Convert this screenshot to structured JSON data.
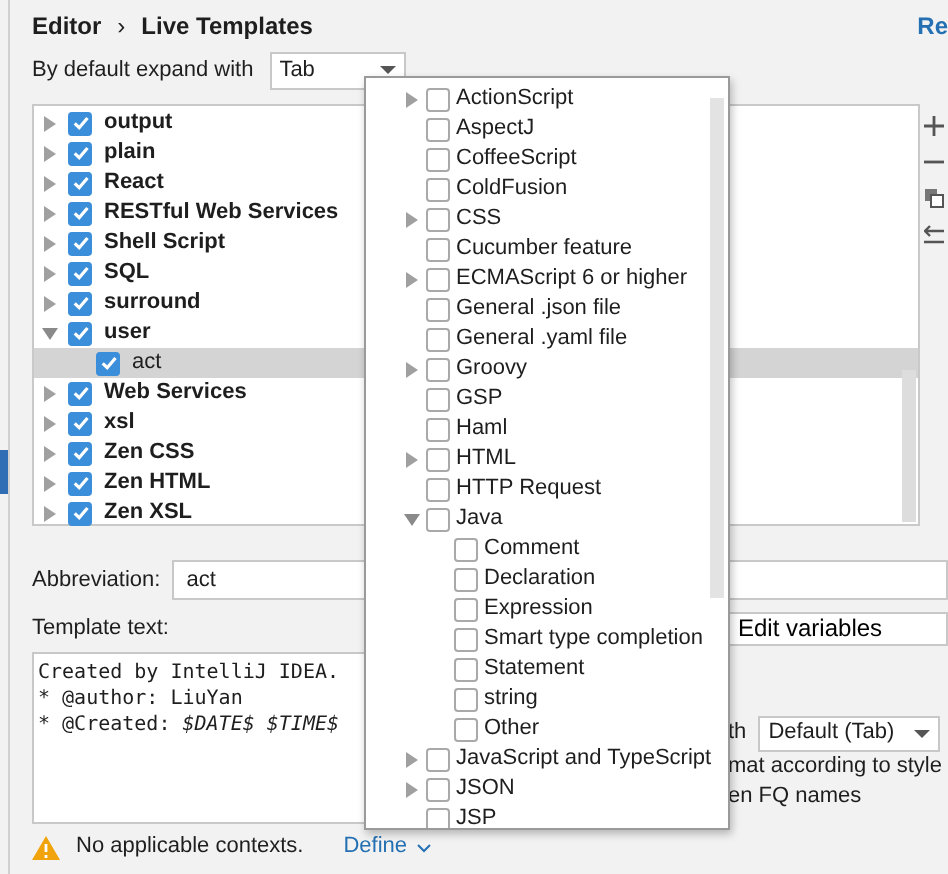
{
  "breadcrumb": {
    "items": [
      "Editor",
      "Live Templates"
    ],
    "separator": "›"
  },
  "reset_link": "Re",
  "expand_with": {
    "label": "By default expand with",
    "value": "Tab"
  },
  "template_groups": [
    {
      "name": "output",
      "checked": true,
      "expanded": false
    },
    {
      "name": "plain",
      "checked": true,
      "expanded": false
    },
    {
      "name": "React",
      "checked": true,
      "expanded": false
    },
    {
      "name": "RESTful Web Services",
      "checked": true,
      "expanded": false
    },
    {
      "name": "Shell Script",
      "checked": true,
      "expanded": false
    },
    {
      "name": "SQL",
      "checked": true,
      "expanded": false
    },
    {
      "name": "surround",
      "checked": true,
      "expanded": false
    },
    {
      "name": "user",
      "checked": true,
      "expanded": true,
      "children": [
        {
          "name": "act",
          "checked": true,
          "selected": true
        }
      ]
    },
    {
      "name": "Web Services",
      "checked": true,
      "expanded": false
    },
    {
      "name": "xsl",
      "checked": true,
      "expanded": false
    },
    {
      "name": "Zen CSS",
      "checked": true,
      "expanded": false
    },
    {
      "name": "Zen HTML",
      "checked": true,
      "expanded": false
    },
    {
      "name": "Zen XSL",
      "checked": true,
      "expanded": false
    }
  ],
  "abbreviation": {
    "label": "Abbreviation:",
    "value": "act"
  },
  "template_text": {
    "label": "Template text:",
    "lines": [
      "Created by IntelliJ IDEA.",
      "* @author: LiuYan",
      "* @Created: *$DATE$ $TIME$*"
    ]
  },
  "edit_variables_button": "Edit variables",
  "options": {
    "expand_label": "th",
    "expand_value": "Default (Tab)",
    "lines": [
      "mat according to style",
      "en FQ names"
    ]
  },
  "footer": {
    "warning": "No applicable contexts.",
    "link": "Define"
  },
  "context_popup": {
    "items": [
      {
        "name": "ActionScript",
        "checked": false,
        "expanded": false
      },
      {
        "name": "AspectJ",
        "checked": false
      },
      {
        "name": "CoffeeScript",
        "checked": false
      },
      {
        "name": "ColdFusion",
        "checked": false
      },
      {
        "name": "CSS",
        "checked": false,
        "expanded": false
      },
      {
        "name": "Cucumber feature",
        "checked": false
      },
      {
        "name": "ECMAScript 6 or higher",
        "checked": false,
        "expanded": false
      },
      {
        "name": "General .json file",
        "checked": false
      },
      {
        "name": "General .yaml file",
        "checked": false
      },
      {
        "name": "Groovy",
        "checked": false,
        "expanded": false
      },
      {
        "name": "GSP",
        "checked": false
      },
      {
        "name": "Haml",
        "checked": false
      },
      {
        "name": "HTML",
        "checked": false,
        "expanded": false
      },
      {
        "name": "HTTP Request",
        "checked": false
      },
      {
        "name": "Java",
        "checked": false,
        "expanded": true,
        "children": [
          {
            "name": "Comment",
            "checked": false
          },
          {
            "name": "Declaration",
            "checked": false
          },
          {
            "name": "Expression",
            "checked": false
          },
          {
            "name": "Smart type completion",
            "checked": false
          },
          {
            "name": "Statement",
            "checked": false
          },
          {
            "name": "string",
            "checked": false
          },
          {
            "name": "Other",
            "checked": false
          }
        ]
      },
      {
        "name": "JavaScript and TypeScript",
        "checked": false,
        "expanded": false
      },
      {
        "name": "JSON",
        "checked": false,
        "expanded": false
      },
      {
        "name": "JSP",
        "checked": false
      }
    ]
  }
}
